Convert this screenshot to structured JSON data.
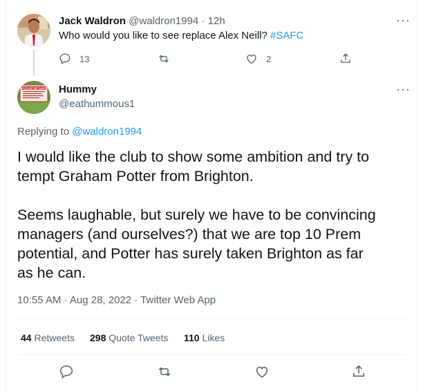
{
  "parent": {
    "author_name": "Jack Waldron",
    "handle": "@waldron1994",
    "separator": "·",
    "time": "12h",
    "text": "Who would you like to see replace Alex Neill?",
    "hashtag": "#SAFC",
    "replies": "13",
    "likes": "2",
    "icons": [
      "reply-icon",
      "retweet-icon",
      "like-icon",
      "share-icon",
      "more-icon"
    ]
  },
  "tweet": {
    "author_name": "Hummy",
    "handle": "@eathummous1",
    "avatar_sign_text": "PLEASE BE SAFE",
    "replying_label": "Replying to",
    "replying_handle": "@waldron1994",
    "body_line1": "I would like the club to show some ambition and try to",
    "body_line2": "tempt Graham Potter from Brighton.",
    "body_line3": "Seems laughable, but surely we have to be convincing",
    "body_line4": "managers (and ourselves?) that we are top 10 Prem",
    "body_line5": "potential, and Potter has surely taken Brighton as far",
    "body_line6": "as he can.",
    "timestamp": "10:55 AM · Aug 28, 2022 · Twitter Web App",
    "stats": {
      "retweets_count": "44",
      "retweets_label": "Retweets",
      "quotes_count": "298",
      "quotes_label": "Quote Tweets",
      "likes_count": "110",
      "likes_label": "Likes"
    },
    "icons": [
      "reply-icon",
      "retweet-icon",
      "like-icon",
      "share-icon",
      "more-icon"
    ]
  },
  "colors": {
    "accent": "#1d9bf0",
    "text": "#0f1419",
    "muted": "#536471",
    "border": "#eff3f4"
  }
}
